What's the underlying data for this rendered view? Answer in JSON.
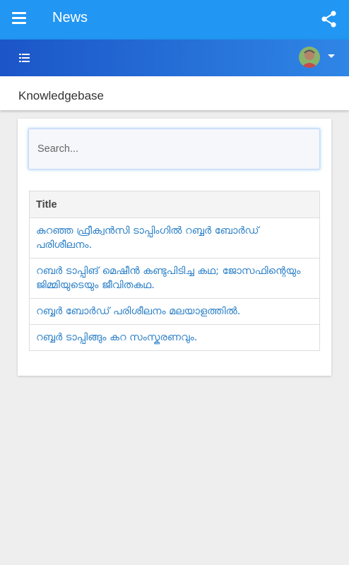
{
  "appbar": {
    "title": "News",
    "icons": {
      "menu": "hamburger-icon",
      "share": "share-icon"
    },
    "color": "#2196f3"
  },
  "subbar": {
    "icons": {
      "list": "list-icon",
      "dropdown": "caret-down-icon",
      "avatar": "user-avatar"
    },
    "gradient": [
      "#1b55c7",
      "#2f86e6"
    ]
  },
  "page": {
    "heading": "Knowledgebase"
  },
  "search": {
    "placeholder": "Search...",
    "value": ""
  },
  "table": {
    "header": "Title",
    "rows": [
      "കുറഞ്ഞ ഫ്രീക്വൻസി ടാപ്പിംഗിൽ റബ്ബർ ബോർഡ് പരിശീലനം.",
      "റബർ ടാപ്പിങ് മെഷീൻ കണ്ടുപിടിച്ച കഥ; ജോസഫിന്റെയും ജിമ്മിയുടെയും ജീവിതകഥ.",
      "റബ്ബർ ബോർഡ് പരിശീലനം മലയാളത്തിൽ.",
      "റബ്ബർ ടാപ്പിങ്ങും കറ സംസ്കരണവും."
    ],
    "link_color": "#2a7fc7"
  }
}
